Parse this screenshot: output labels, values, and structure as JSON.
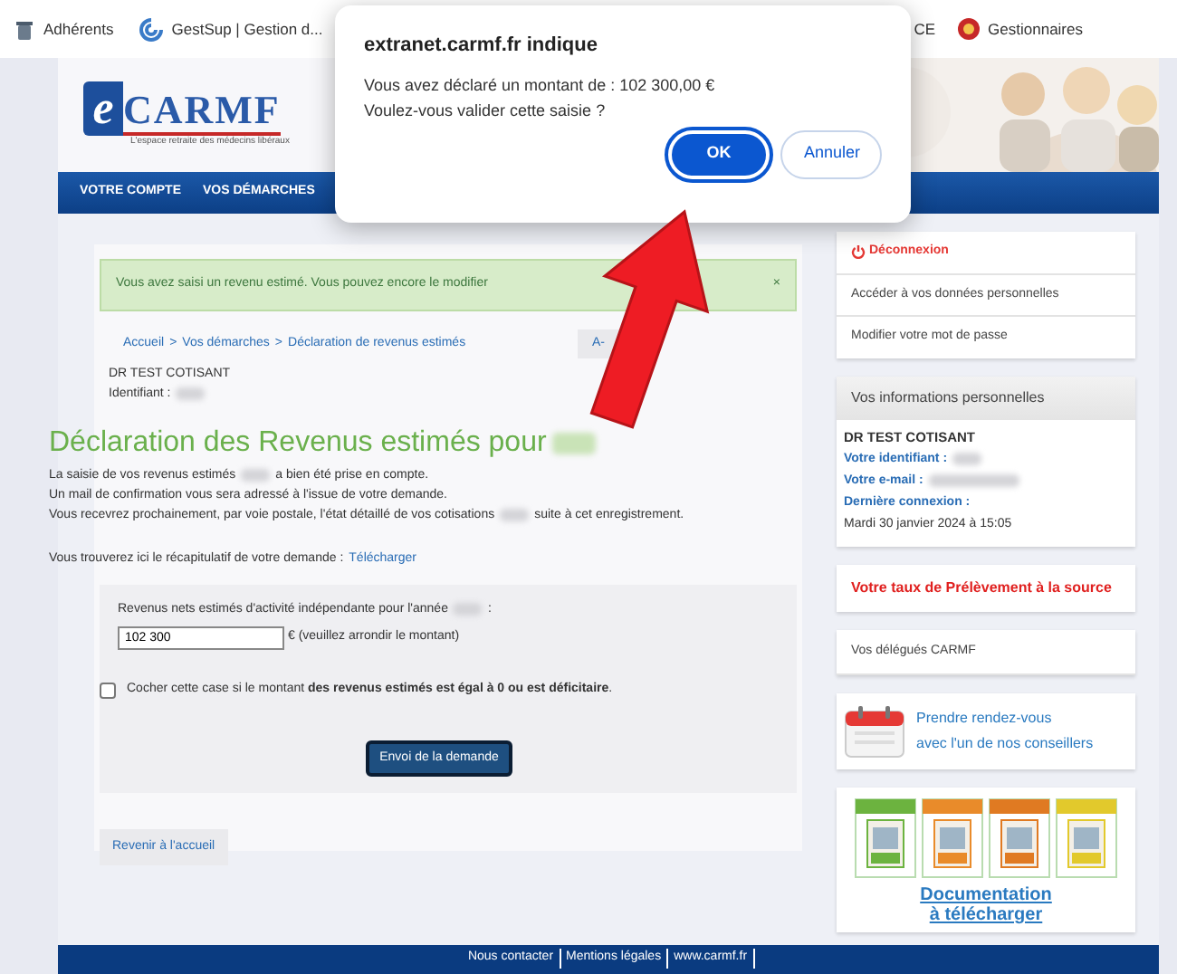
{
  "bookmarks": [
    {
      "label": "Adhérents"
    },
    {
      "label": "GestSup | Gestion d..."
    },
    {
      "label": "CE"
    },
    {
      "label": "Gestionnaires"
    }
  ],
  "logo": {
    "letter": "e",
    "name": "CARMF",
    "tagline": "L'espace retraite des médecins libéraux"
  },
  "nav": [
    {
      "label": "VOTRE COMPTE"
    },
    {
      "label": "VOS DÉMARCHES"
    }
  ],
  "alert": {
    "text": "Vous avez saisi un revenu estimé. Vous pouvez encore le modifier",
    "close": "×"
  },
  "breadcrumb": [
    {
      "label": "Accueil"
    },
    {
      "label": "Vos démarches"
    },
    {
      "label": "Déclaration de revenus estimés"
    }
  ],
  "breadcrumb_separator": ">",
  "font_button": "A-",
  "member": {
    "name": "DR TEST COTISANT",
    "id": [
      {
        "kind": "text",
        "text": "Identifiant :"
      },
      {
        "kind": "redacted"
      }
    ]
  },
  "heading": [
    {
      "kind": "text",
      "text": "Déclaration des Revenus estimés pour"
    },
    {
      "kind": "redacted"
    }
  ],
  "intro": [
    [
      {
        "kind": "text",
        "text": "La saisie de vos revenus estimés"
      },
      {
        "kind": "redacted"
      },
      {
        "kind": "text",
        "text": "a bien été prise en compte."
      }
    ],
    [
      {
        "kind": "text",
        "text": "Un mail de confirmation vous sera adressé à l'issue de votre demande."
      }
    ],
    [
      {
        "kind": "text",
        "text": "Vous recevrez prochainement, par voie postale, l'état détaillé de vos cotisations"
      },
      {
        "kind": "redacted"
      },
      {
        "kind": "text",
        "text": "suite à cet enregistrement."
      }
    ]
  ],
  "recap": {
    "text": "Vous trouverez ici le récapitulatif de votre demande :",
    "link": "Télécharger"
  },
  "form": {
    "label": [
      {
        "kind": "text",
        "text": "Revenus nets estimés d'activité indépendante pour l'année"
      },
      {
        "kind": "redacted"
      },
      {
        "kind": "text",
        "text": ":"
      }
    ],
    "value": "102 300",
    "unit": "€ (veuillez arrondir le montant)",
    "checkbox": {
      "label": "Cocher cette case si le montant **des revenus estimés est égal à 0 ou est déficitaire**.",
      "checked": false
    },
    "submit": "Envoi de la demande"
  },
  "back_button": "Revenir à l'accueil",
  "account_menu": [
    {
      "label": "Déconnexion",
      "kind": "logout"
    },
    {
      "label": "Accéder à vos données personnelles",
      "kind": "link"
    },
    {
      "label": "Modifier votre mot de passe",
      "kind": "link"
    }
  ],
  "info": {
    "title": "Vos informations personnelles",
    "name": "DR TEST COTISANT",
    "rows": [
      [
        {
          "kind": "label",
          "text": "Votre identifiant :"
        },
        {
          "kind": "redacted"
        }
      ],
      [
        {
          "kind": "label",
          "text": "Votre e-mail :"
        },
        {
          "kind": "redacted_long"
        }
      ],
      [
        {
          "kind": "label",
          "text": "Dernière connexion :"
        }
      ],
      [
        {
          "kind": "text",
          "text": "Mardi 30 janvier 2024 à 15:05"
        }
      ]
    ]
  },
  "tax_rate": "Votre taux de Prélèvement à la source",
  "delegates": "Vos délégués CARMF",
  "appointment": [
    "Prendre rendez-vous",
    "avec l'un de nos conseillers"
  ],
  "guides": [
    {
      "color": "#6cb33f"
    },
    {
      "color": "#e98b2a"
    },
    {
      "color": "#e07a22"
    },
    {
      "color": "#e2c92c"
    }
  ],
  "documentation": [
    "Documentation",
    "à télécharger"
  ],
  "footer": [
    "Nous contacter",
    "Mentions légales",
    "www.carmf.fr"
  ],
  "dialog": {
    "title": "extranet.carmf.fr indique",
    "lines": [
      "Vous avez déclaré un montant de : 102 300,00 €",
      "Voulez-vous valider cette saisie ?"
    ],
    "buttons": [
      {
        "label": "OK",
        "kind": "primary"
      },
      {
        "label": "Annuler",
        "kind": "secondary"
      }
    ]
  }
}
